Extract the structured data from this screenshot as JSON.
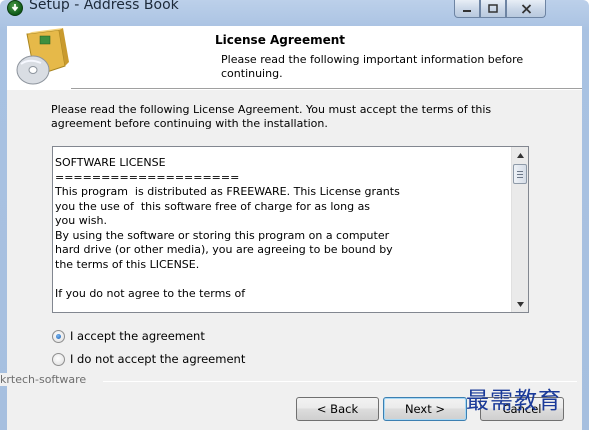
{
  "window": {
    "title": "Setup - Address Book"
  },
  "header": {
    "title": "License Agreement",
    "subtitle": "Please read the following important information before continuing."
  },
  "intro": "Please read the following License Agreement. You must accept the terms of this agreement before continuing with the installation.",
  "license": {
    "lines": [
      "SOFTWARE LICENSE",
      "====================",
      "This program  is distributed as FREEWARE. This License grants",
      "you the use of  this software free of charge for as long as",
      "you wish.",
      "By using the software or storing this program on a computer",
      "hard drive (or other media), you are agreeing to be bound by",
      "the terms of this LICENSE.",
      "",
      "If you do not agree to the terms of"
    ]
  },
  "options": {
    "accept": "I accept the agreement",
    "decline": "I do not accept the agreement",
    "selected": "accept"
  },
  "brand": "krtech-software",
  "buttons": {
    "back": "< Back",
    "next": "Next >",
    "cancel": "Cancel"
  },
  "watermark": "最需教育",
  "icons": {
    "app": "setup-icon",
    "header": "disc-box-icon",
    "minimize": "minimize-icon",
    "maximize": "maximize-icon",
    "close": "close-icon"
  }
}
